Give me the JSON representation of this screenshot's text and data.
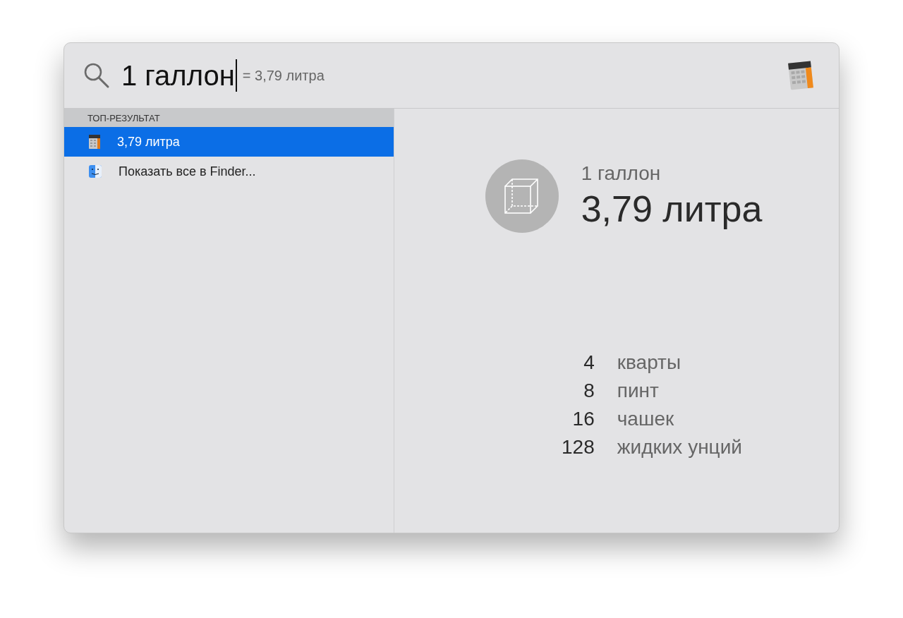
{
  "search": {
    "value": "1 галлон",
    "suggestion": "= 3,79 литра"
  },
  "section_title": "ТОП-РЕЗУЛЬТАТ",
  "results": [
    {
      "label": "3,79 литра",
      "kind": "calculator",
      "selected": true
    },
    {
      "label": "Показать все в Finder...",
      "kind": "finder",
      "selected": false
    }
  ],
  "preview": {
    "query": "1 галлон",
    "result": "3,79 литра"
  },
  "conversions": [
    {
      "amount": "4",
      "unit": "кварты"
    },
    {
      "amount": "8",
      "unit": "пинт"
    },
    {
      "amount": "16",
      "unit": "чашек"
    },
    {
      "amount": "128",
      "unit": "жидких унций"
    }
  ]
}
